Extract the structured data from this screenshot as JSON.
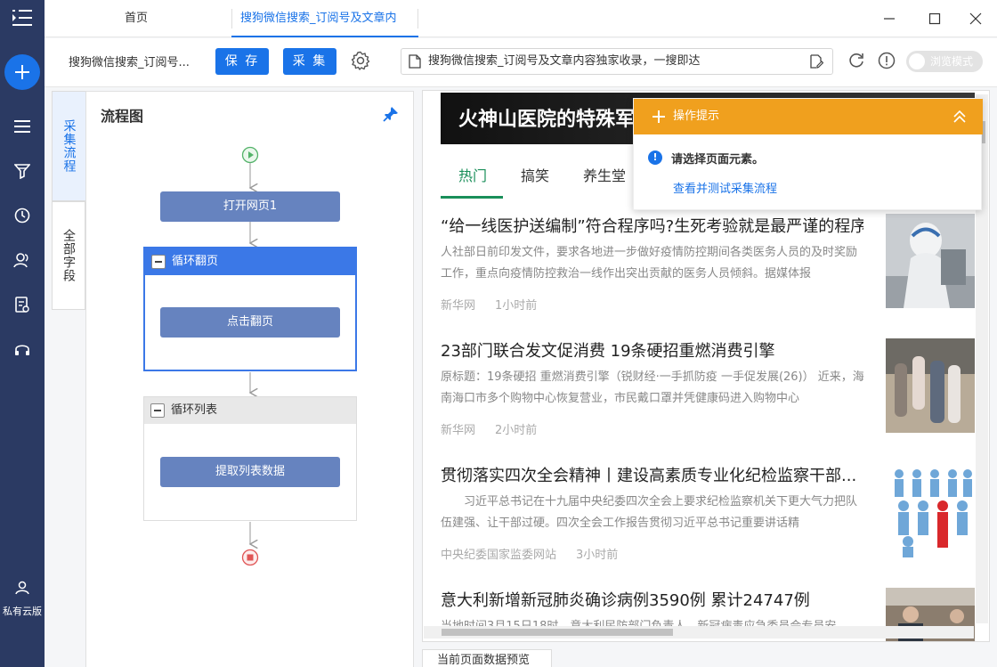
{
  "rail": {
    "items": [
      "menu-collapse",
      "new-task",
      "task-list",
      "filter",
      "run-history",
      "team",
      "data-export",
      "support"
    ],
    "user_label": "私有云版"
  },
  "titlebar": {
    "tabs": [
      {
        "label": "首页"
      },
      {
        "label": "搜狗微信搜索_订阅号及文章内"
      }
    ]
  },
  "toolbar": {
    "task_name": "搜狗微信搜索_订阅号...",
    "save_label": "保 存",
    "collect_label": "采 集",
    "url": "搜狗微信搜索_订阅号及文章内容独家收录，一搜即达",
    "browse_mode_label": "浏览模式"
  },
  "sidetabs": {
    "flow": "采集流程",
    "fields": "全部字段"
  },
  "flow": {
    "title": "流程图",
    "nodes": {
      "open_page": "打开网页1",
      "loop_page": "循环翻页",
      "click_page": "点击翻页",
      "loop_list": "循环列表",
      "extract": "提取列表数据"
    }
  },
  "page": {
    "banner": "火神山医院的特殊军",
    "nav": [
      "热门",
      "搞笑",
      "养生堂"
    ],
    "articles": [
      {
        "title": "“给一线医护送编制”符合程序吗?生死考验就是最严谨的程序",
        "summary": "人社部日前印发文件，要求各地进一步做好疫情防控期间各类医务人员的及时奖励工作，重点向疫情防控救治一线作出突出贡献的医务人员倾斜。据媒体报",
        "source": "新华网",
        "time": "1小时前"
      },
      {
        "title": "23部门联合发文促消费 19条硬招重燃消费引擎",
        "summary": "原标题：19条硬招 重燃消费引擎（锐财经·一手抓防疫 一手促发展(26)） 近来，海南海口市多个购物中心恢复营业，市民戴口罩并凭健康码进入购物中心",
        "source": "新华网",
        "time": "2小时前"
      },
      {
        "title": "贯彻落实四次全会精神丨建设高素质专业化纪检监察干部...",
        "summary": "　　习近平总书记在十九届中央纪委四次全会上要求纪检监察机关下更大气力把队伍建强、让干部过硬。四次全会工作报告贯彻习近平总书记重要讲话精",
        "source": "中央纪委国家监委网站",
        "time": "3小时前"
      },
      {
        "title": "意大利新增新冠肺炎确诊病例3590例 累计24747例",
        "summary": "当地时间3月15日18时，意大利民防部门负责人、新冠病毒应急委员会专员安",
        "source": "",
        "time": ""
      }
    ]
  },
  "tips": {
    "title": "操作提示",
    "message": "请选择页面元素。",
    "link": "查看并测试采集流程"
  },
  "preview_tab": "当前页面数据预览",
  "colors": {
    "rail": "#2b3a63",
    "primary": "#1a73e8",
    "node": "#6683bf",
    "tips_header": "#f0a01e",
    "nav_active": "#1a8f5a"
  }
}
